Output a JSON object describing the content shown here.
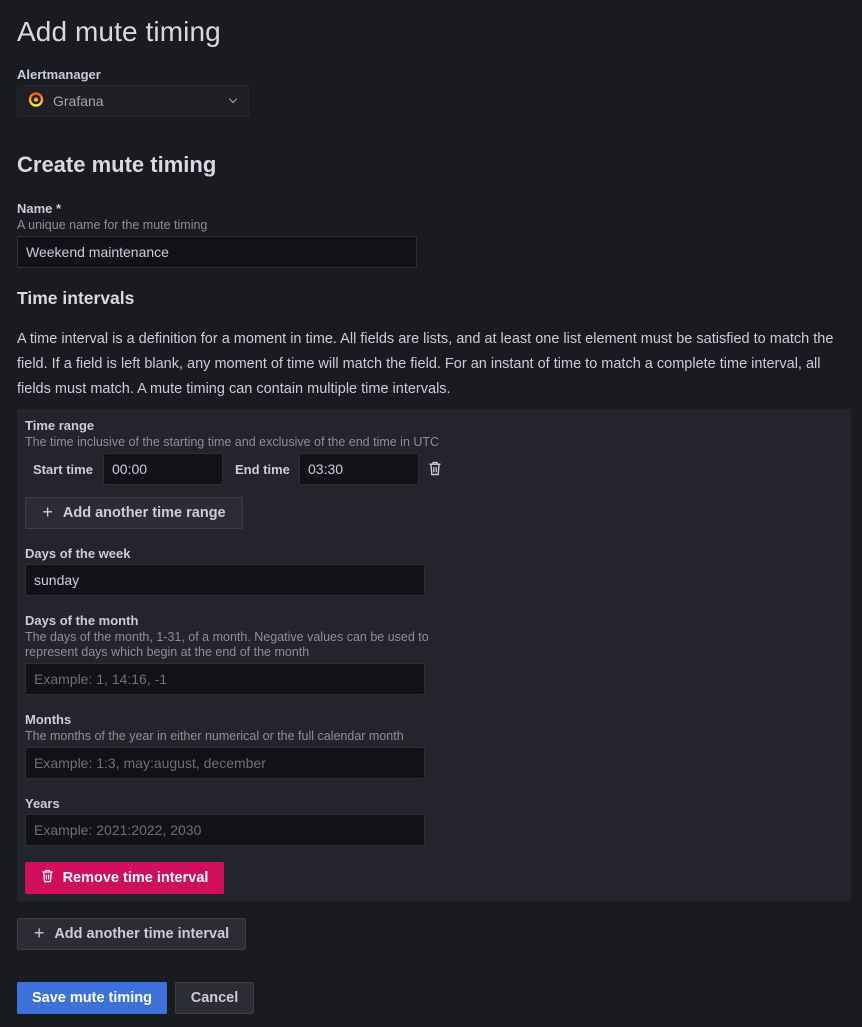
{
  "page": {
    "title": "Add mute timing"
  },
  "alertmanager": {
    "label": "Alertmanager",
    "selected": "Grafana",
    "icon": "grafana-logo-icon"
  },
  "form": {
    "heading": "Create mute timing",
    "name": {
      "label": "Name *",
      "description": "A unique name for the mute timing",
      "value": "Weekend maintenance"
    }
  },
  "time_intervals": {
    "heading": "Time intervals",
    "description": "A time interval is a definition for a moment in time. All fields are lists, and at least one list element must be satisfied to match the field. If a field is left blank, any moment of time will match the field. For an instant of time to match a complete time interval, all fields must match. A mute timing can contain multiple time intervals.",
    "interval": {
      "time_range": {
        "label": "Time range",
        "description": "The time inclusive of the starting time and exclusive of the end time in UTC",
        "start_label": "Start time",
        "start_value": "00:00",
        "end_label": "End time",
        "end_value": "03:30",
        "add_label": "Add another time range"
      },
      "days_of_week": {
        "label": "Days of the week",
        "value": "sunday"
      },
      "days_of_month": {
        "label": "Days of the month",
        "description_line1": "The days of the month, 1-31, of a month. Negative values can be used to",
        "description_line2": "represent days which begin at the end of the month",
        "placeholder": "Example: 1, 14:16, -1"
      },
      "months": {
        "label": "Months",
        "description": "The months of the year in either numerical or the full calendar month",
        "placeholder": "Example: 1:3, may:august, december"
      },
      "years": {
        "label": "Years",
        "placeholder": "Example: 2021:2022, 2030"
      },
      "remove_label": "Remove time interval"
    },
    "add_interval_label": "Add another time interval"
  },
  "actions": {
    "save_label": "Save mute timing",
    "cancel_label": "Cancel"
  },
  "colors": {
    "primary": "#3d71d9",
    "danger": "#d10e5c",
    "background": "#181b1f",
    "panel": "#22252b"
  }
}
